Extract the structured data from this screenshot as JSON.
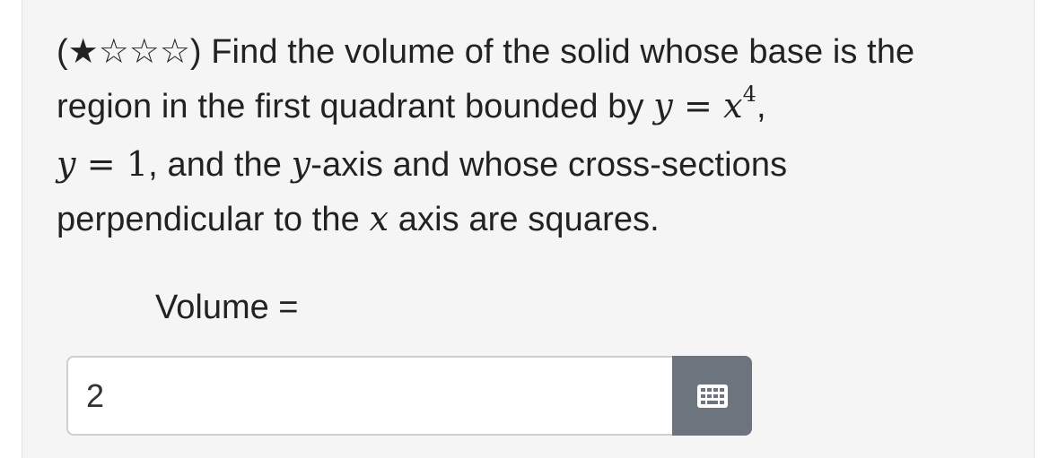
{
  "question": {
    "difficulty": "(★☆☆☆)",
    "text_1": " Find the volume of the solid whose base is the region in the first quadrant bounded by ",
    "eq1_lhs": "y",
    "eq1_op": " = ",
    "eq1_rhs": "x",
    "eq1_exp": "4",
    "text_2": ", ",
    "eq2_lhs": "y",
    "eq2_op": " = ",
    "eq2_rhs": "1",
    "text_3": ", and the ",
    "axis_y": "y",
    "text_4": "-axis and whose cross-sections perpendicular to the ",
    "axis_x": "x",
    "text_5": " axis are squares."
  },
  "answer": {
    "label": "Volume =",
    "value": "2",
    "keypad_icon": "keypad-icon"
  }
}
